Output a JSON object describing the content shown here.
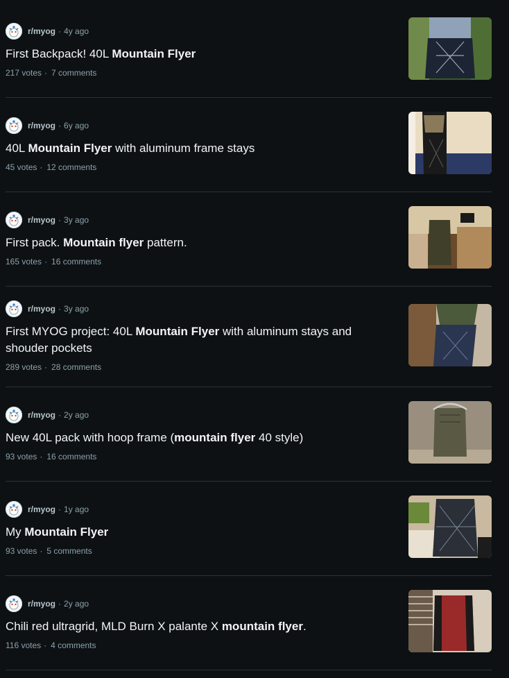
{
  "posts": [
    {
      "subreddit": "r/myog",
      "age": "4y ago",
      "title": [
        {
          "t": "First Backpack! 40L ",
          "b": false
        },
        {
          "t": "Mountain Flyer",
          "b": true
        }
      ],
      "votes": "217 votes",
      "comments": "7 comments",
      "thumb_colors": [
        "#3a5a2a",
        "#6f8a4a",
        "#1d2433",
        "#8fa2b8"
      ]
    },
    {
      "subreddit": "r/myog",
      "age": "6y ago",
      "title": [
        {
          "t": "40L ",
          "b": false
        },
        {
          "t": "Mountain Flyer",
          "b": true
        },
        {
          "t": " with aluminum frame stays",
          "b": false
        }
      ],
      "votes": "45 votes",
      "comments": "12 comments",
      "thumb_colors": [
        "#e9dcc3",
        "#2c3a66",
        "#1a1a1a",
        "#8a7a5a"
      ]
    },
    {
      "subreddit": "r/myog",
      "age": "3y ago",
      "title": [
        {
          "t": "First pack. ",
          "b": false
        },
        {
          "t": "Mountain flyer",
          "b": true
        },
        {
          "t": " pattern.",
          "b": false
        }
      ],
      "votes": "165 votes",
      "comments": "16 comments",
      "thumb_colors": [
        "#b08a5a",
        "#3f3f2a",
        "#d8c7a4",
        "#6a4a2a"
      ]
    },
    {
      "subreddit": "r/myog",
      "age": "3y ago",
      "title": [
        {
          "t": "First MYOG project: 40L ",
          "b": false
        },
        {
          "t": "Mountain Flyer",
          "b": true
        },
        {
          "t": " with aluminum stays and shouder pockets",
          "b": false
        }
      ],
      "votes": "289 votes",
      "comments": "28 comments",
      "thumb_colors": [
        "#7a5a3a",
        "#2a3550",
        "#4a5a3a",
        "#c4b8a4"
      ]
    },
    {
      "subreddit": "r/myog",
      "age": "2y ago",
      "title": [
        {
          "t": "New 40L pack with hoop frame (",
          "b": false
        },
        {
          "t": "mountain flyer",
          "b": true
        },
        {
          "t": " 40 style)",
          "b": false
        }
      ],
      "votes": "93 votes",
      "comments": "16 comments",
      "thumb_colors": [
        "#9a8f7e",
        "#5a5a44",
        "#b7aa94",
        "#3a3a30"
      ]
    },
    {
      "subreddit": "r/myog",
      "age": "1y ago",
      "title": [
        {
          "t": "My ",
          "b": false
        },
        {
          "t": "Mountain Flyer",
          "b": true
        }
      ],
      "votes": "93 votes",
      "comments": "5 comments",
      "thumb_colors": [
        "#2a2f38",
        "#6a8a3a",
        "#c9b9a0",
        "#1c1c1c"
      ]
    },
    {
      "subreddit": "r/myog",
      "age": "2y ago",
      "title": [
        {
          "t": "Chili red ultragrid, MLD Burn X palante X ",
          "b": false
        },
        {
          "t": "mountain flyer",
          "b": true
        },
        {
          "t": ".",
          "b": false
        }
      ],
      "votes": "116 votes",
      "comments": "4 comments",
      "thumb_colors": [
        "#d8ccbc",
        "#9a2a2a",
        "#1a1a1a",
        "#6a5a4a"
      ]
    }
  ],
  "separator": "·"
}
